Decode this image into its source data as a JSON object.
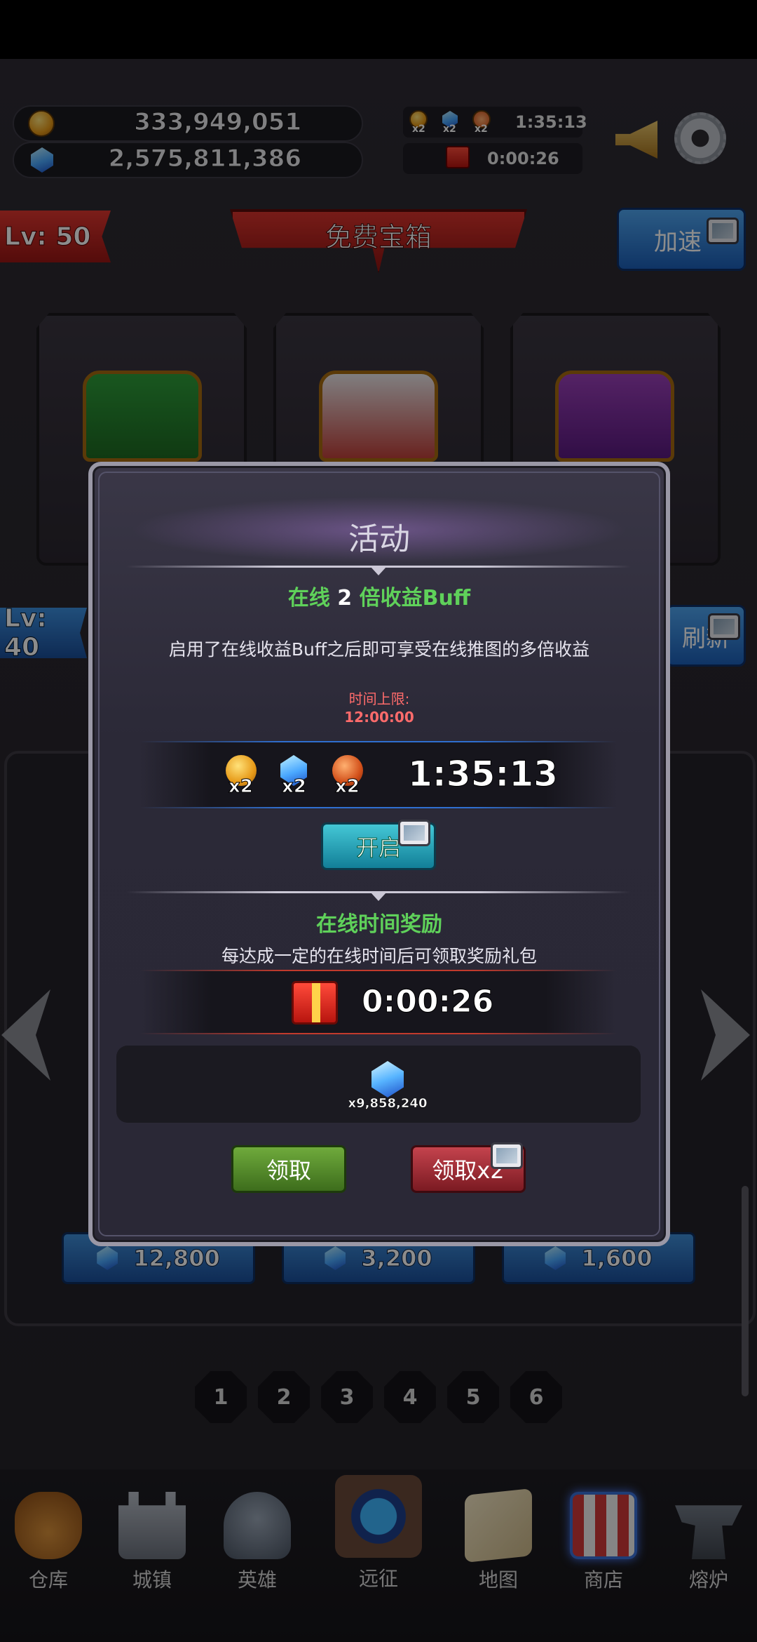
{
  "resources": {
    "gold": "333,949,051",
    "gems": "2,575,811,386",
    "buff_x2_labels": [
      "x2",
      "x2",
      "x2"
    ],
    "buff_timer": "1:35:13",
    "gift_timer": "0:00:26"
  },
  "header": {
    "level_top": "Lv: 50",
    "title": "免费宝箱",
    "speedup_label": "加速",
    "level_mid": "Lv: 40",
    "refresh_label": "刷新"
  },
  "prices": [
    "12,800",
    "3,200",
    "1,600"
  ],
  "pages": [
    "1",
    "2",
    "3",
    "4",
    "5",
    "6"
  ],
  "bottom_nav": [
    {
      "label": "仓库",
      "icon": "bag-icon"
    },
    {
      "label": "城镇",
      "icon": "castle-icon"
    },
    {
      "label": "英雄",
      "icon": "helmet-icon"
    },
    {
      "label": "远征",
      "icon": "portal-icon"
    },
    {
      "label": "地图",
      "icon": "map-icon"
    },
    {
      "label": "商店",
      "icon": "shop-icon"
    },
    {
      "label": "熔炉",
      "icon": "anvil-icon"
    }
  ],
  "dialog": {
    "title": "活动",
    "buff_heading_pre": "在线 ",
    "buff_heading_num": "2",
    "buff_heading_post": " 倍收益Buff",
    "buff_desc": "启用了在线收益Buff之后即可享受在线推图的多倍收益",
    "time_limit_label": "时间上限:",
    "time_limit_value": "12:00:00",
    "buff_multipliers": [
      "x2",
      "x2",
      "x2"
    ],
    "buff_timer": "1:35:13",
    "enable_button": "开启",
    "reward_heading": "在线时间奖励",
    "reward_desc": "每达成一定的在线时间后可领取奖励礼包",
    "gift_timer": "0:00:26",
    "reward_amount": "x9,858,240",
    "claim_button": "领取",
    "claim_double_button": "领取x2"
  },
  "colors": {
    "accent_green": "#5fd15a",
    "accent_red": "#ff6b6b",
    "banner_red": "#d9332c",
    "button_blue": "#4fa5f0"
  }
}
